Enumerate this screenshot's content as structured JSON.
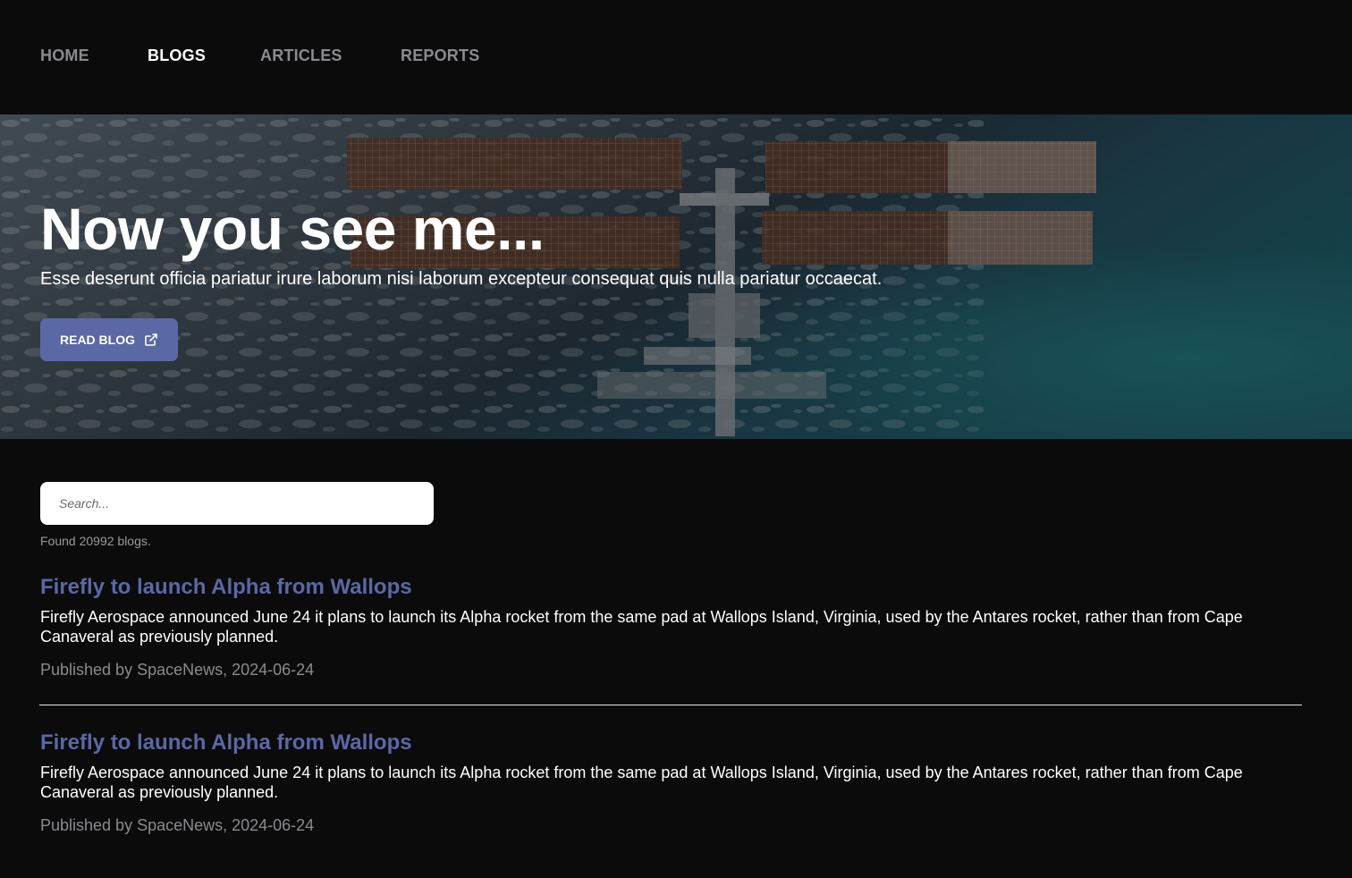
{
  "nav": {
    "items": [
      {
        "label": "HOME",
        "active": false
      },
      {
        "label": "BLOGS",
        "active": true
      },
      {
        "label": "ARTICLES",
        "active": false
      },
      {
        "label": "REPORTS",
        "active": false
      }
    ]
  },
  "hero": {
    "title": "Now you see me...",
    "subtitle": "Esse deserunt officia pariatur irure laborum nisi laborum excepteur consequat quis nulla pariatur occaecat.",
    "button_label": "READ BLOG",
    "button_icon": "external-link-icon"
  },
  "search": {
    "placeholder": "Search...",
    "value": "",
    "result_count_text": "Found 20992 blogs."
  },
  "blogs": [
    {
      "title": "Firefly to launch Alpha from Wallops",
      "excerpt": "Firefly Aerospace announced June 24 it plans to launch its Alpha rocket from the same pad at Wallops Island, Virginia, used by the Antares rocket, rather than from Cape Canaveral as previously planned.",
      "meta": "Published by SpaceNews, 2024-06-24"
    },
    {
      "title": "Firefly to launch Alpha from Wallops",
      "excerpt": "Firefly Aerospace announced June 24 it plans to launch its Alpha rocket from the same pad at Wallops Island, Virginia, used by the Antares rocket, rather than from Cape Canaveral as previously planned.",
      "meta": "Published by SpaceNews, 2024-06-24"
    }
  ],
  "colors": {
    "background": "#0b0b0c",
    "accent": "#5a68a6",
    "nav_inactive": "#8a8a8f",
    "muted_text": "#8a8a8f"
  }
}
